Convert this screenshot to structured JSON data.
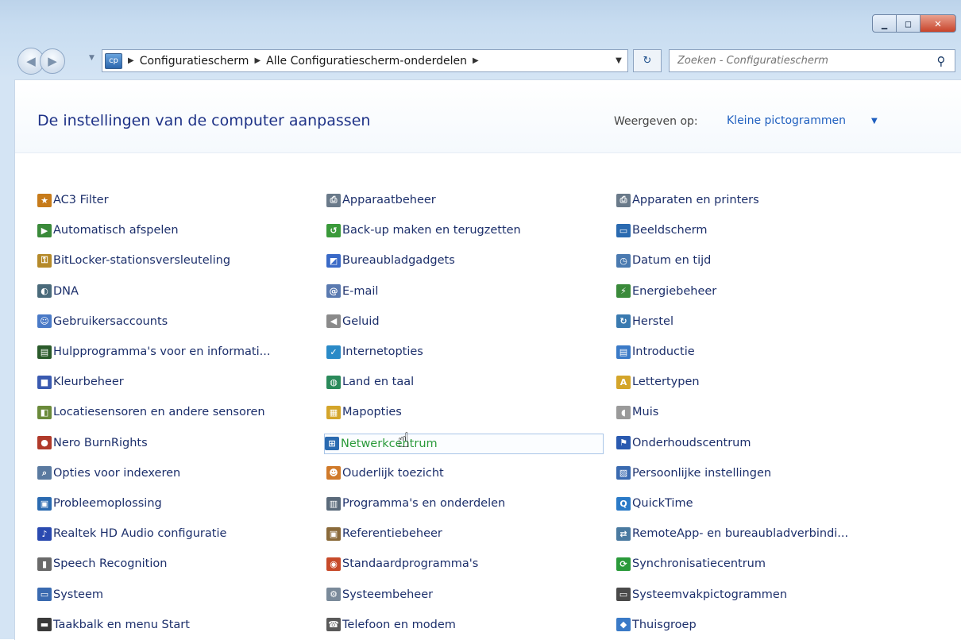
{
  "window": {
    "controls": {
      "minimize": "▁",
      "maximize": "□",
      "close": "✕"
    }
  },
  "nav": {
    "back_icon": "◀",
    "forward_icon": "▶",
    "address_icon": "cp",
    "breadcrumbs": [
      "Configuratiescherm",
      "Alle Configuratiescherm-onderdelen"
    ],
    "breadcrumb_sep": "▶",
    "refresh_icon": "↻",
    "search_placeholder": "Zoeken - Configuratiescherm",
    "search_icon": "⚲"
  },
  "header": {
    "title": "De instellingen van de computer aanpassen",
    "viewby_label": "Weergeven op:",
    "viewby_value": "Kleine pictogrammen",
    "viewby_caret": "▼"
  },
  "items": [
    {
      "label": "AC3 Filter",
      "icon": "ac3-filter-icon",
      "color": "#c77b1a",
      "glyph": "★"
    },
    {
      "label": "Automatisch afspelen",
      "icon": "autoplay-icon",
      "color": "#3a8a3a",
      "glyph": "▶"
    },
    {
      "label": "BitLocker-stationsversleuteling",
      "icon": "bitlocker-icon",
      "color": "#b58a2a",
      "glyph": "⚿"
    },
    {
      "label": "DNA",
      "icon": "dna-icon",
      "color": "#4a6a7a",
      "glyph": "◐"
    },
    {
      "label": "Gebruikersaccounts",
      "icon": "user-accounts-icon",
      "color": "#4a7ac7",
      "glyph": "☺"
    },
    {
      "label": "Hulpprogramma's voor en informati...",
      "icon": "performance-tools-icon",
      "color": "#2a5a2a",
      "glyph": "▤"
    },
    {
      "label": "Kleurbeheer",
      "icon": "color-management-icon",
      "color": "#3a5ab0",
      "glyph": "■"
    },
    {
      "label": "Locatiesensoren en andere sensoren",
      "icon": "location-sensors-icon",
      "color": "#6a8a3a",
      "glyph": "◧"
    },
    {
      "label": "Nero BurnRights",
      "icon": "nero-burnrights-icon",
      "color": "#b03a2a",
      "glyph": "●"
    },
    {
      "label": "Opties voor indexeren",
      "icon": "indexing-options-icon",
      "color": "#5a7aa0",
      "glyph": "⌕"
    },
    {
      "label": "Probleemoplossing",
      "icon": "troubleshooting-icon",
      "color": "#2a6ab0",
      "glyph": "▣"
    },
    {
      "label": "Realtek HD Audio configuratie",
      "icon": "realtek-audio-icon",
      "color": "#2a4ab0",
      "glyph": "♪"
    },
    {
      "label": "Speech Recognition",
      "icon": "microphone-icon",
      "color": "#6a6a6a",
      "glyph": "▮"
    },
    {
      "label": "Systeem",
      "icon": "system-icon",
      "color": "#3a6ab0",
      "glyph": "▭"
    },
    {
      "label": "Taakbalk en menu Start",
      "icon": "taskbar-icon",
      "color": "#3a3a3a",
      "glyph": "▬"
    },
    {
      "label": "Apparaatbeheer",
      "icon": "device-manager-icon",
      "color": "#6a7a8a",
      "glyph": "⎙"
    },
    {
      "label": "Back-up maken en terugzetten",
      "icon": "backup-icon",
      "color": "#3a9a3a",
      "glyph": "↺"
    },
    {
      "label": "Bureaubladgadgets",
      "icon": "desktop-gadgets-icon",
      "color": "#3a6ac7",
      "glyph": "◩"
    },
    {
      "label": "E-mail",
      "icon": "email-icon",
      "color": "#5a7ab0",
      "glyph": "@"
    },
    {
      "label": "Geluid",
      "icon": "speaker-icon",
      "color": "#8a8a8a",
      "glyph": "◀"
    },
    {
      "label": "Internetopties",
      "icon": "internet-options-icon",
      "color": "#2a8ac7",
      "glyph": "✓"
    },
    {
      "label": "Land en taal",
      "icon": "globe-icon",
      "color": "#2a8a5a",
      "glyph": "◍"
    },
    {
      "label": "Mapopties",
      "icon": "folder-options-icon",
      "color": "#d4a52a",
      "glyph": "▦"
    },
    {
      "label": "Netwerkcentrum",
      "icon": "network-center-icon",
      "color": "#2a6ab0",
      "glyph": "⊞"
    },
    {
      "label": "Ouderlijk toezicht",
      "icon": "parental-controls-icon",
      "color": "#d07a2a",
      "glyph": "☻"
    },
    {
      "label": "Programma's en onderdelen",
      "icon": "programs-features-icon",
      "color": "#5a6a7a",
      "glyph": "▥"
    },
    {
      "label": "Referentiebeheer",
      "icon": "credential-manager-icon",
      "color": "#8a6a3a",
      "glyph": "▣"
    },
    {
      "label": "Standaardprogramma's",
      "icon": "default-programs-icon",
      "color": "#c74a2a",
      "glyph": "◉"
    },
    {
      "label": "Systeembeheer",
      "icon": "admin-tools-icon",
      "color": "#7a8a9a",
      "glyph": "⚙"
    },
    {
      "label": "Telefoon en modem",
      "icon": "phone-modem-icon",
      "color": "#5a5a5a",
      "glyph": "☎"
    },
    {
      "label": "Apparaten en printers",
      "icon": "printer-icon",
      "color": "#6a7a8a",
      "glyph": "⎙"
    },
    {
      "label": "Beeldscherm",
      "icon": "display-icon",
      "color": "#2a6ab0",
      "glyph": "▭"
    },
    {
      "label": "Datum en tijd",
      "icon": "clock-icon",
      "color": "#4a7ab0",
      "glyph": "◷"
    },
    {
      "label": "Energiebeheer",
      "icon": "power-icon",
      "color": "#3a8a3a",
      "glyph": "⚡"
    },
    {
      "label": "Herstel",
      "icon": "recovery-icon",
      "color": "#3a7ab0",
      "glyph": "↻"
    },
    {
      "label": "Introductie",
      "icon": "getting-started-icon",
      "color": "#3a7ac7",
      "glyph": "▤"
    },
    {
      "label": "Lettertypen",
      "icon": "fonts-icon",
      "color": "#d4a52a",
      "glyph": "A"
    },
    {
      "label": "Muis",
      "icon": "mouse-icon",
      "color": "#9a9a9a",
      "glyph": "◖"
    },
    {
      "label": "Onderhoudscentrum",
      "icon": "flag-icon",
      "color": "#2a5ab0",
      "glyph": "⚑"
    },
    {
      "label": "Persoonlijke instellingen",
      "icon": "personalization-icon",
      "color": "#3a6ab0",
      "glyph": "▨"
    },
    {
      "label": "QuickTime",
      "icon": "quicktime-icon",
      "color": "#2a7ac7",
      "glyph": "Q"
    },
    {
      "label": "RemoteApp- en bureaubladverbindi...",
      "icon": "remoteapp-icon",
      "color": "#4a7aa0",
      "glyph": "⇄"
    },
    {
      "label": "Synchronisatiecentrum",
      "icon": "sync-center-icon",
      "color": "#2a9a3a",
      "glyph": "⟳"
    },
    {
      "label": "Systeemvakpictogrammen",
      "icon": "notification-area-icon",
      "color": "#4a4a4a",
      "glyph": "▭"
    },
    {
      "label": "Thuisgroep",
      "icon": "homegroup-icon",
      "color": "#3a7ac7",
      "glyph": "◆"
    }
  ],
  "hovered_item": "Netwerkcentrum",
  "colors": {
    "link": "#1c2f6b",
    "title": "#1e3287",
    "hover_text": "#2a9a3a",
    "accent": "#1f5fbf"
  }
}
